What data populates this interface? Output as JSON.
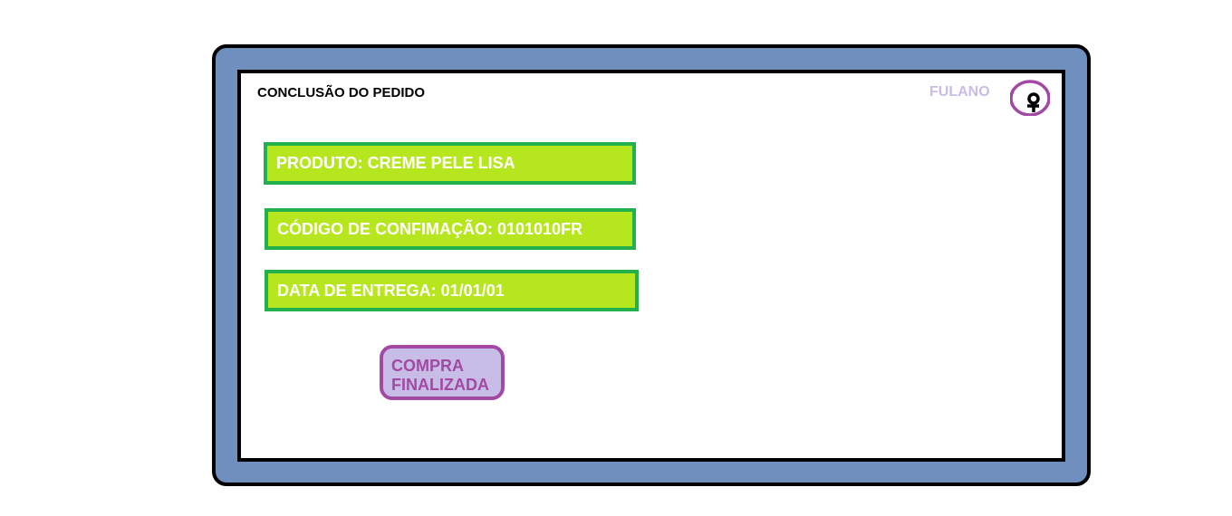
{
  "header": {
    "title": "CONCLUSÃO DO PEDIDO",
    "user_name": "FULANO",
    "avatar_icon": "user-icon"
  },
  "order": {
    "product": "PRODUTO: CREME PELE LISA",
    "confirmation_code": "CÓDIGO DE CONFIMAÇÃO: 0101010FR",
    "delivery_date": "DATA DE ENTREGA: 01/01/01"
  },
  "actions": {
    "finish_label": "COMPRA\nFINALIZADA"
  },
  "colors": {
    "frame": "#6f90bf",
    "field_fill": "#b6e61e",
    "field_border": "#22b14c",
    "button_fill": "#c8bde6",
    "button_border": "#a349a4",
    "user_name": "#c8bde6"
  }
}
